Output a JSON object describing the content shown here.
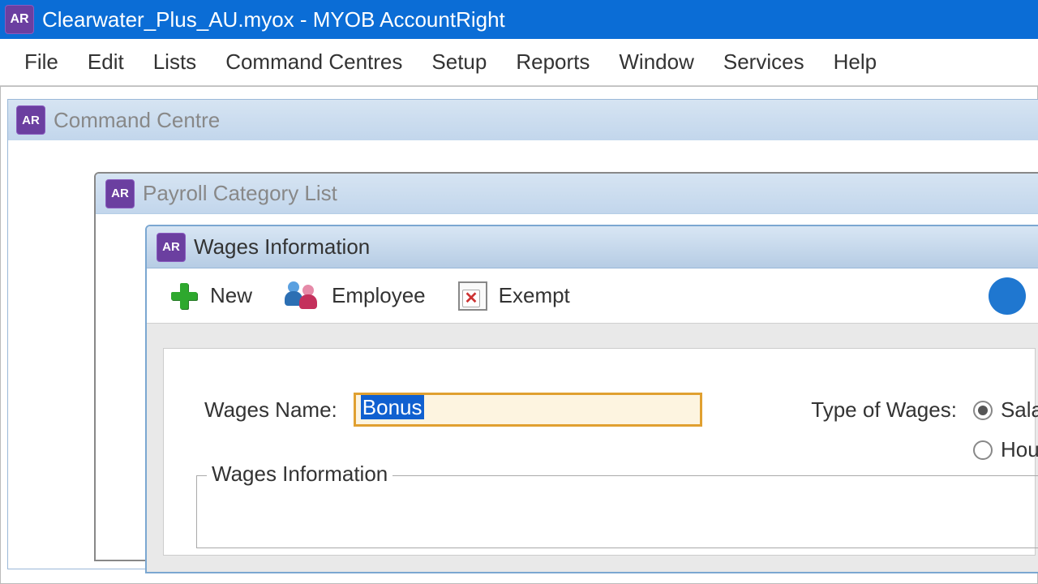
{
  "titlebar": {
    "icon_text": "AR",
    "title": "Clearwater_Plus_AU.myox - MYOB AccountRight"
  },
  "menu": [
    "File",
    "Edit",
    "Lists",
    "Command Centres",
    "Setup",
    "Reports",
    "Window",
    "Services",
    "Help"
  ],
  "windows": {
    "command_centre": {
      "icon_text": "AR",
      "title": "Command Centre"
    },
    "payroll_category_list": {
      "icon_text": "AR",
      "title": "Payroll Category List"
    },
    "wages_information": {
      "icon_text": "AR",
      "title": "Wages Information",
      "toolbar": {
        "new_label": "New",
        "employee_label": "Employee",
        "exempt_label": "Exempt"
      },
      "form": {
        "wages_name_label": "Wages Name:",
        "wages_name_value": "Bonus",
        "type_of_wages_label": "Type of Wages:",
        "radio_salary_label": "Sala",
        "radio_hourly_label": "Hou",
        "radio_selected": "salary",
        "groupbox_title": "Wages Information"
      }
    }
  }
}
